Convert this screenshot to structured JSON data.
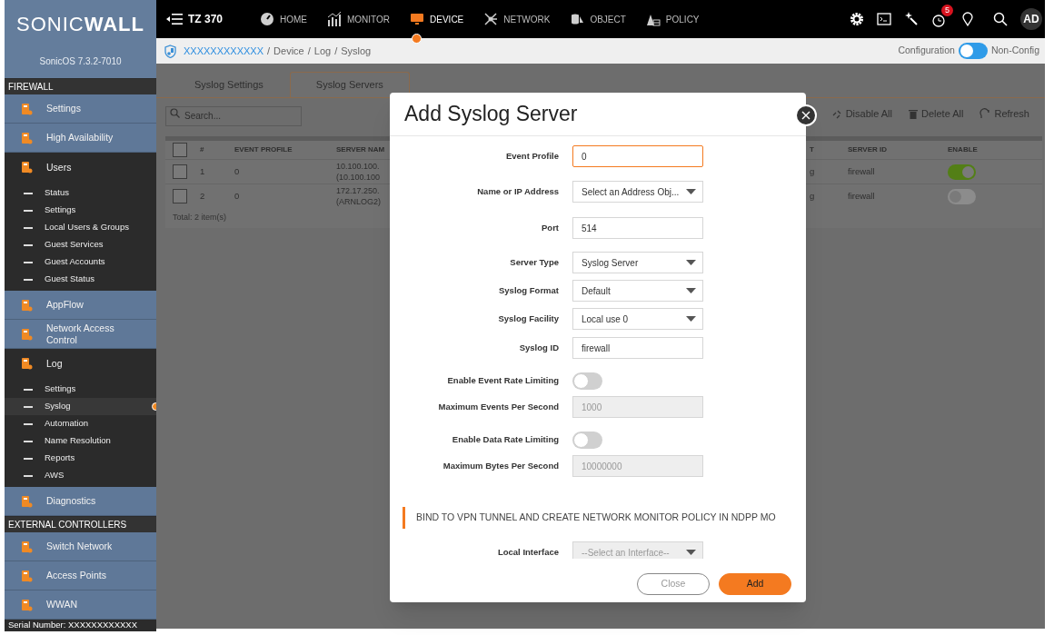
{
  "brand": {
    "logo": "SONIC**WALL**",
    "version": "SonicOS 7.3.2-7010"
  },
  "sidebar": {
    "sections": [
      {
        "heading": "FIREWALL",
        "items": [
          {
            "label": "Settings",
            "expanded": false
          },
          {
            "label": "High Availability",
            "expanded": false
          },
          {
            "label": "Users",
            "expanded": true,
            "children": [
              {
                "label": "Status",
                "selected": false
              },
              {
                "label": "Settings",
                "selected": false
              },
              {
                "label": "Local Users & Groups",
                "selected": false
              },
              {
                "label": "Guest Services",
                "selected": false
              },
              {
                "label": "Guest Accounts",
                "selected": false
              },
              {
                "label": "Guest Status",
                "selected": false
              }
            ]
          },
          {
            "label": "AppFlow",
            "expanded": false
          },
          {
            "label": "Network Access Control",
            "expanded": false
          },
          {
            "label": "Log",
            "expanded": true,
            "children": [
              {
                "label": "Settings",
                "selected": false
              },
              {
                "label": "Syslog",
                "selected": true
              },
              {
                "label": "Automation",
                "selected": false
              },
              {
                "label": "Name Resolution",
                "selected": false
              },
              {
                "label": "Reports",
                "selected": false
              },
              {
                "label": "AWS",
                "selected": false
              }
            ]
          },
          {
            "label": "Diagnostics",
            "expanded": false
          }
        ]
      },
      {
        "heading": "EXTERNAL CONTROLLERS",
        "items": [
          {
            "label": "Switch Network",
            "expanded": false
          },
          {
            "label": "Access Points",
            "expanded": false
          },
          {
            "label": "WWAN",
            "expanded": false
          }
        ]
      }
    ],
    "footer": "Serial Number: XXXXXXXXXXXX"
  },
  "header": {
    "title": "TZ 370",
    "nav": [
      {
        "label": "HOME",
        "selected": false
      },
      {
        "label": "MONITOR",
        "selected": false
      },
      {
        "label": "DEVICE",
        "selected": true
      },
      {
        "label": "NETWORK",
        "selected": false
      },
      {
        "label": "OBJECT",
        "selected": false
      },
      {
        "label": "POLICY",
        "selected": false
      }
    ],
    "alert_count": "5",
    "avatar": "AD"
  },
  "breadcrumb": {
    "root": "XXXXXXXXXXXX",
    "separator": "/",
    "path": [
      "Device",
      "Log",
      "Syslog"
    ]
  },
  "mode_switch": {
    "left_label": "Configuration",
    "right_label": "Non-Config",
    "non_config": false
  },
  "tabs": [
    {
      "label": "Syslog Settings",
      "selected": false
    },
    {
      "label": "Syslog Servers",
      "selected": true
    }
  ],
  "toolbar": {
    "search_placeholder": "Search...",
    "actions": [
      "Disable All",
      "Delete All",
      "Refresh"
    ]
  },
  "table": {
    "header_checked": false,
    "columns": [
      "#",
      "EVENT PROFILE",
      "SERVER NAM",
      "T",
      "SERVER ID",
      "ENABLE"
    ],
    "rows": [
      {
        "checked": false,
        "index": "1",
        "event_profile": "0",
        "server_name": [
          "10.100.100.",
          "(10.100.100"
        ],
        "column_4": "g",
        "server_id": "firewall",
        "enabled": true
      },
      {
        "checked": false,
        "index": "2",
        "event_profile": "0",
        "server_name": [
          "172.17.250.",
          "(ARNLOG2)"
        ],
        "column_4": "g",
        "server_id": "firewall",
        "enabled": false
      }
    ],
    "total": "Total: 2 item(s)"
  },
  "dialog": {
    "title": "Add Syslog Server",
    "fields": [
      {
        "kind": "text",
        "label": "Event Profile",
        "value": "0",
        "focused": true
      },
      {
        "kind": "select",
        "label": "Name or IP Address",
        "value": "Select an Address Obj..."
      },
      {
        "kind": "text",
        "label": "Port",
        "value": "514",
        "focused": false
      },
      {
        "kind": "select",
        "label": "Server Type",
        "value": "Syslog Server"
      },
      {
        "kind": "select",
        "label": "Syslog Format",
        "value": "Default"
      },
      {
        "kind": "select",
        "label": "Syslog Facility",
        "value": "Local use 0"
      },
      {
        "kind": "text",
        "label": "Syslog ID",
        "value": "firewall",
        "focused": false
      },
      {
        "kind": "toggle",
        "label": "Enable Event Rate Limiting",
        "on": false
      },
      {
        "kind": "number",
        "label": "Maximum Events Per Second",
        "value": "1000",
        "disabled": true
      },
      {
        "kind": "toggle",
        "label": "Enable Data Rate Limiting",
        "on": false
      },
      {
        "kind": "number",
        "label": "Maximum Bytes Per Second",
        "value": "10000000",
        "disabled": true
      }
    ],
    "section_heading": "BIND TO VPN TUNNEL AND CREATE NETWORK MONITOR POLICY IN NDPP MO",
    "section_fields": [
      {
        "kind": "select",
        "label": "Local Interface",
        "value": "--Select an Interface--",
        "disabled": true
      }
    ],
    "buttons": [
      {
        "label": "Close",
        "kind": "secondary"
      },
      {
        "label": "Add",
        "kind": "primary"
      }
    ]
  }
}
